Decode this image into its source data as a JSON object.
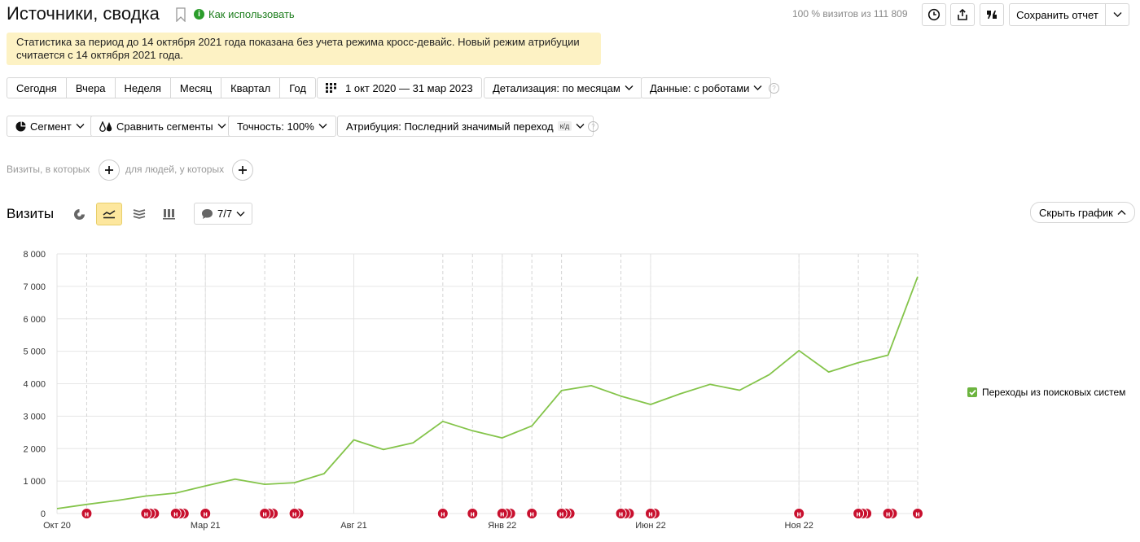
{
  "header": {
    "title": "Источники, сводка",
    "howto": "Как использовать",
    "visits_info": "100 % визитов из 111 809",
    "save_report": "Сохранить отчет"
  },
  "notice": {
    "line1": "Статистика за период до 14 октября 2021 года показана без учета режима кросс-девайс. Новый режим атрибуции",
    "line2": "считается с 14 октября 2021 года."
  },
  "period_tabs": [
    "Сегодня",
    "Вчера",
    "Неделя",
    "Месяц",
    "Квартал",
    "Год"
  ],
  "filters": {
    "date_range": "1 окт 2020 — 31 мар 2023",
    "detail": "Детализация: по месяцам",
    "data": "Данные: с роботами",
    "segment": "Сегмент",
    "compare": "Сравнить сегменты",
    "accuracy": "Точность: 100%",
    "attribution": "Атрибуция: Последний значимый переход",
    "attribution_badge": "к/д"
  },
  "conditions": {
    "visits": "Визиты, в которых",
    "people": "для людей, у которых"
  },
  "chart_header": {
    "title": "Визиты",
    "annotations": "7/7",
    "hide": "Скрыть график"
  },
  "colors": {
    "line": "#84c44a",
    "marker": "#c8102e",
    "notice": "#fdf2c4",
    "active_tab": "#fde79e"
  },
  "chart_data": {
    "type": "line",
    "title": "",
    "xlabel": "",
    "ylabel": "",
    "ylim": [
      0,
      8000
    ],
    "yticks": [
      0,
      1000,
      2000,
      3000,
      4000,
      5000,
      6000,
      7000,
      8000
    ],
    "ytick_labels": [
      "0",
      "1 000",
      "2 000",
      "3 000",
      "4 000",
      "5 000",
      "6 000",
      "7 000",
      "8 000"
    ],
    "x": [
      "2020-10",
      "2020-11",
      "2020-12",
      "2021-01",
      "2021-02",
      "2021-03",
      "2021-04",
      "2021-05",
      "2021-06",
      "2021-07",
      "2021-08",
      "2021-09",
      "2021-10",
      "2021-11",
      "2021-12",
      "2022-01",
      "2022-02",
      "2022-03",
      "2022-04",
      "2022-05",
      "2022-06",
      "2022-07",
      "2022-08",
      "2022-09",
      "2022-10",
      "2022-11",
      "2022-12",
      "2023-01",
      "2023-02",
      "2023-03"
    ],
    "xtick_labels": [
      {
        "label": "Окт 20",
        "x": "2020-10"
      },
      {
        "label": "Мар 21",
        "x": "2021-03"
      },
      {
        "label": "Авг 21",
        "x": "2021-08"
      },
      {
        "label": "Янв 22",
        "x": "2022-01"
      },
      {
        "label": "Июн 22",
        "x": "2022-06"
      },
      {
        "label": "Ноя 22",
        "x": "2022-11"
      }
    ],
    "series": [
      {
        "name": "Переходы из поисковых систем",
        "values": [
          150,
          280,
          400,
          540,
          630,
          850,
          1060,
          900,
          950,
          1230,
          2270,
          1970,
          2180,
          2840,
          2550,
          2330,
          2700,
          3790,
          3940,
          3620,
          3360,
          3690,
          3980,
          3800,
          4280,
          5020,
          4360,
          4650,
          4880,
          7300
        ]
      }
    ],
    "annotation_markers": [
      {
        "x": "2020-11",
        "count": 1
      },
      {
        "x": "2021-01",
        "count": 3
      },
      {
        "x": "2021-02",
        "count": 3
      },
      {
        "x": "2021-03",
        "count": 1
      },
      {
        "x": "2021-05",
        "count": 3
      },
      {
        "x": "2021-06",
        "count": 2
      },
      {
        "x": "2021-11",
        "count": 1
      },
      {
        "x": "2021-12",
        "count": 1
      },
      {
        "x": "2022-01",
        "count": 3
      },
      {
        "x": "2022-02",
        "count": 1
      },
      {
        "x": "2022-03",
        "count": 3
      },
      {
        "x": "2022-05",
        "count": 3
      },
      {
        "x": "2022-06",
        "count": 2
      },
      {
        "x": "2022-11",
        "count": 1
      },
      {
        "x": "2023-01",
        "count": 3
      },
      {
        "x": "2023-02",
        "count": 2
      },
      {
        "x": "2023-03",
        "count": 1
      }
    ],
    "marker_label": "н",
    "grid": true,
    "legend": "right"
  }
}
